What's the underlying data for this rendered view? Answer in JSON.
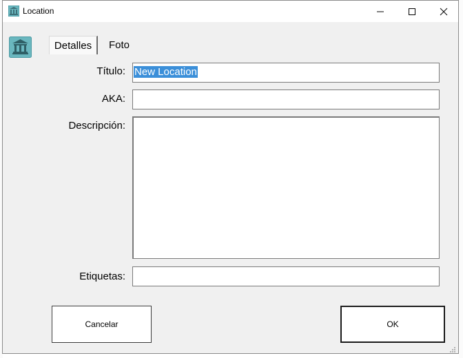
{
  "window": {
    "title": "Location",
    "app_icon": "museum-icon",
    "controls": {
      "minimize": "minimize-icon",
      "maximize": "maximize-icon",
      "close": "close-icon"
    }
  },
  "sidebar": {
    "icon": "museum-icon"
  },
  "tabs": [
    {
      "label": "Detalles",
      "active": true
    },
    {
      "label": "Foto",
      "active": false
    }
  ],
  "form": {
    "titulo": {
      "label": "Título:",
      "value": "New Location"
    },
    "aka": {
      "label": "AKA:",
      "value": ""
    },
    "descripcion": {
      "label": "Descripción:",
      "value": ""
    },
    "etiquetas": {
      "label": "Etiquetas:",
      "value": ""
    }
  },
  "buttons": {
    "cancel": "Cancelar",
    "ok": "OK"
  },
  "colors": {
    "selection": "#3b8fd9",
    "icon_teal": "#6ab7bf",
    "window_bg": "#f0f0f0"
  }
}
